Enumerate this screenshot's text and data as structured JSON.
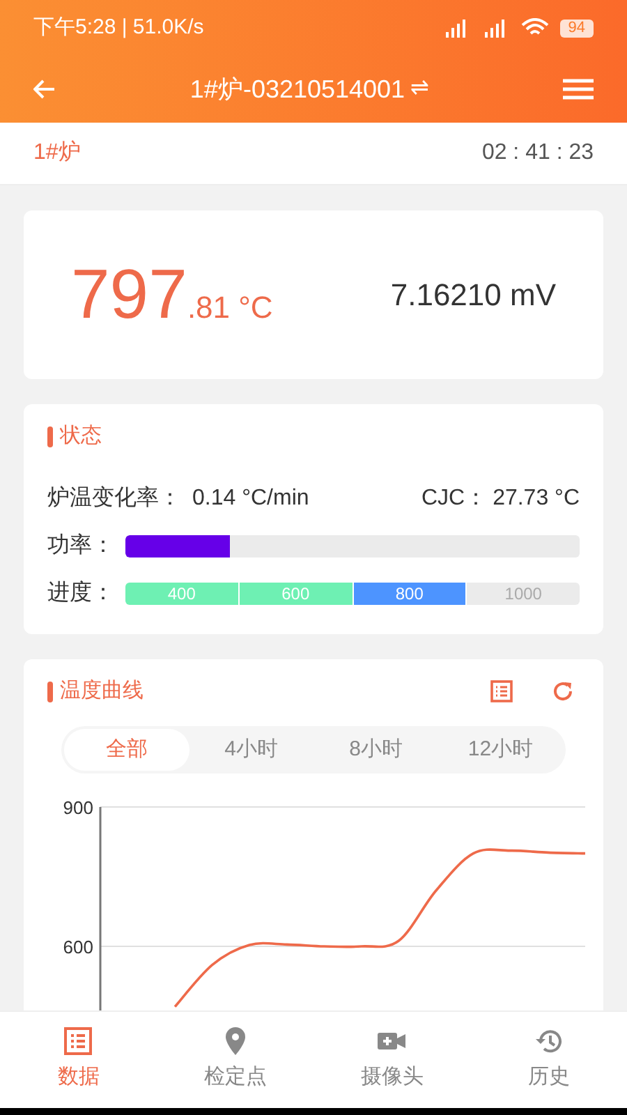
{
  "status_bar": {
    "time": "下午5:28 | 51.0K/s",
    "battery": "94"
  },
  "header": {
    "title": "1#炉-03210514001",
    "swap_icon": "⇌"
  },
  "subheader": {
    "furnace": "1#炉",
    "timer": "02 : 41 : 23"
  },
  "reading": {
    "integer": "797",
    "fraction": ".81 °C",
    "voltage": "7.16210 mV"
  },
  "status": {
    "title": "状态",
    "rate_label": "炉温变化率：",
    "rate_value": "0.14 °C/min",
    "cjc_label": "CJC：",
    "cjc_value": "27.73 °C",
    "power_label": "功率：",
    "power": {
      "level": 0.23
    },
    "progress_label": "进度：",
    "progress": [
      {
        "label": "400",
        "color": "#6ef0b3"
      },
      {
        "label": "600",
        "color": "#6ef0b3"
      },
      {
        "label": "800",
        "color": "#4d94ff"
      },
      {
        "label": "1000",
        "color": "#ebebeb"
      }
    ]
  },
  "curve": {
    "title": "温度曲线",
    "tabs": [
      {
        "label": "全部",
        "selected": true
      },
      {
        "label": "4小时",
        "selected": false
      },
      {
        "label": "8小时",
        "selected": false
      },
      {
        "label": "12小时",
        "selected": false
      }
    ],
    "chart_data": {
      "type": "line",
      "ylim": [
        450,
        900
      ],
      "yticks": [
        600,
        900
      ],
      "values": [
        null,
        null,
        470,
        560,
        603,
        604,
        600,
        600,
        612,
        720,
        800,
        806,
        802,
        800
      ]
    }
  },
  "nav": [
    {
      "label": "数据",
      "selected": true
    },
    {
      "label": "检定点",
      "selected": false
    },
    {
      "label": "摄像头",
      "selected": false
    },
    {
      "label": "历史",
      "selected": false
    }
  ]
}
